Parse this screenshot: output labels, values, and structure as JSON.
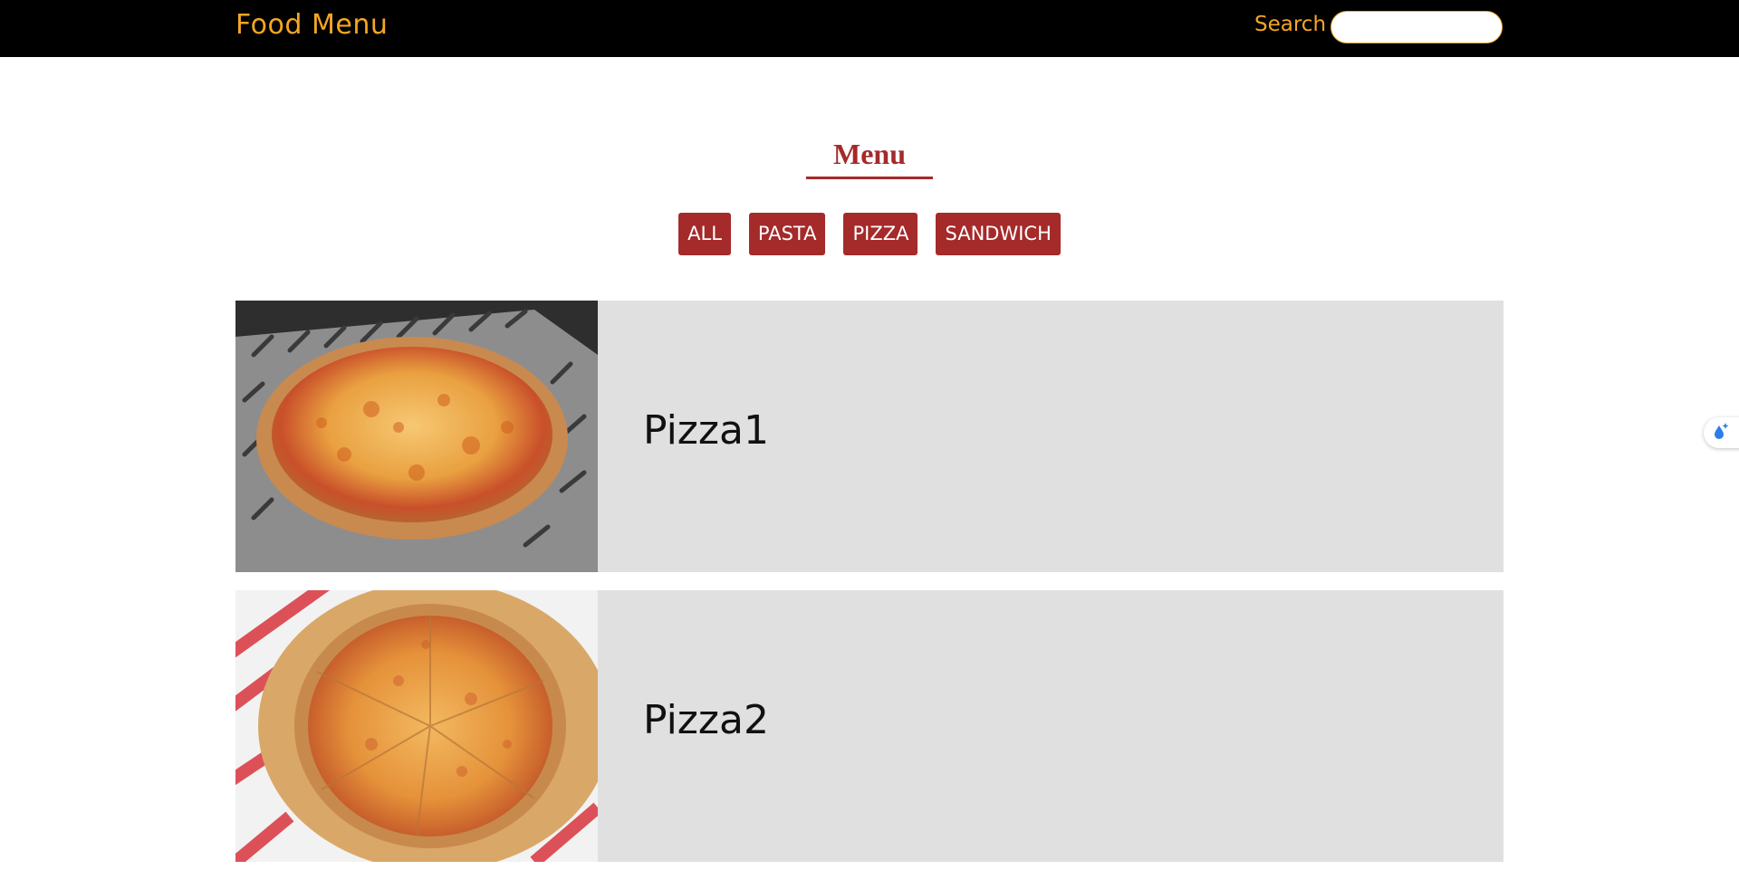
{
  "navbar": {
    "brand": "Food Menu",
    "search_label": "Search",
    "search_value": "",
    "search_placeholder": ""
  },
  "menu": {
    "title": "Menu",
    "filters": [
      {
        "label": "ALL"
      },
      {
        "label": "PASTA"
      },
      {
        "label": "PIZZA"
      },
      {
        "label": "SANDWICH"
      }
    ]
  },
  "items": [
    {
      "name": "Pizza1",
      "image": "pizza-photo"
    },
    {
      "name": "Pizza2",
      "image": "pizza-photo"
    }
  ],
  "side_widget": {
    "icon": "water-drop-sparkle-icon"
  },
  "colors": {
    "nav_bg": "#000000",
    "brand": "#f5a623",
    "accent": "#a52a2a",
    "card_bg": "#e0e0e0"
  }
}
